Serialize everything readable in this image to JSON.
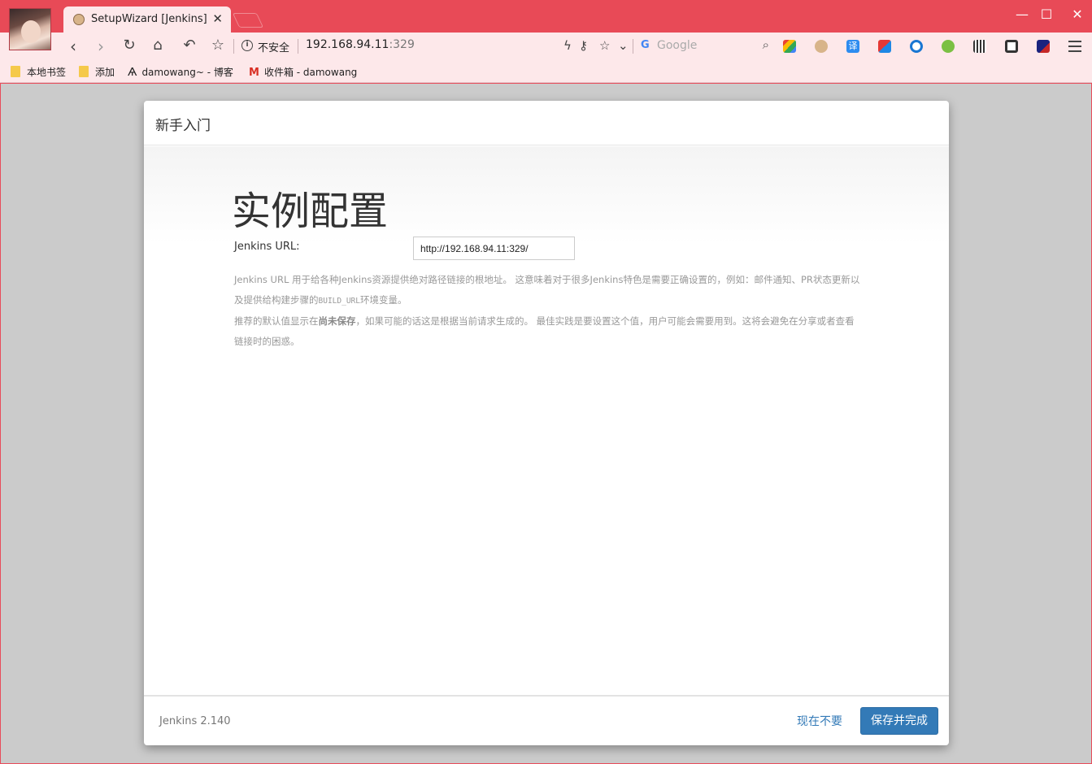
{
  "browser": {
    "tab_title": "SetupWizard [Jenkins]",
    "tab_close": "✕",
    "window_controls": [
      "—",
      "☐",
      "✕"
    ],
    "security_label": "不安全",
    "url_host": "192.168.94.11",
    "url_port": ":329",
    "search_placeholder": "Google",
    "search_g": "G"
  },
  "bookmarks": [
    {
      "label": "本地书签",
      "icon": "folder-icon"
    },
    {
      "label": "添加",
      "icon": "folder-icon"
    },
    {
      "label": "damowang~ - 博客",
      "icon": "blog-icon"
    },
    {
      "label": "收件箱 - damowang",
      "icon": "gmail-icon"
    }
  ],
  "dialog": {
    "header_title": "新手入门",
    "page_title": "实例配置",
    "url_label": "Jenkins URL:",
    "url_value": "http://192.168.94.11:329/",
    "help_line1": "Jenkins URL 用于给各种Jenkins资源提供绝对路径链接的根地址。 这意味着对于很多Jenkins特色是需要正确设置的，例如：邮件通知、PR状态更新以及提供给构建步骤的",
    "help_code": "BUILD_URL",
    "help_line1_end": "环境变量。",
    "help_line2_start": "推荐的默认值显示在",
    "help_strong": "尚未保存",
    "help_line2_end": "，如果可能的话这是根据当前请求生成的。 最佳实践是要设置这个值，用户可能会需要用到。这将会避免在分享或者查看链接时的困惑。",
    "version": "Jenkins 2.140",
    "skip_label": "现在不要",
    "save_label": "保存并完成"
  },
  "colors": {
    "titlebar": "#e84a57",
    "toolbar": "#fde8ea",
    "primary_button": "#337ab7",
    "page_background": "#cbcbcb"
  }
}
